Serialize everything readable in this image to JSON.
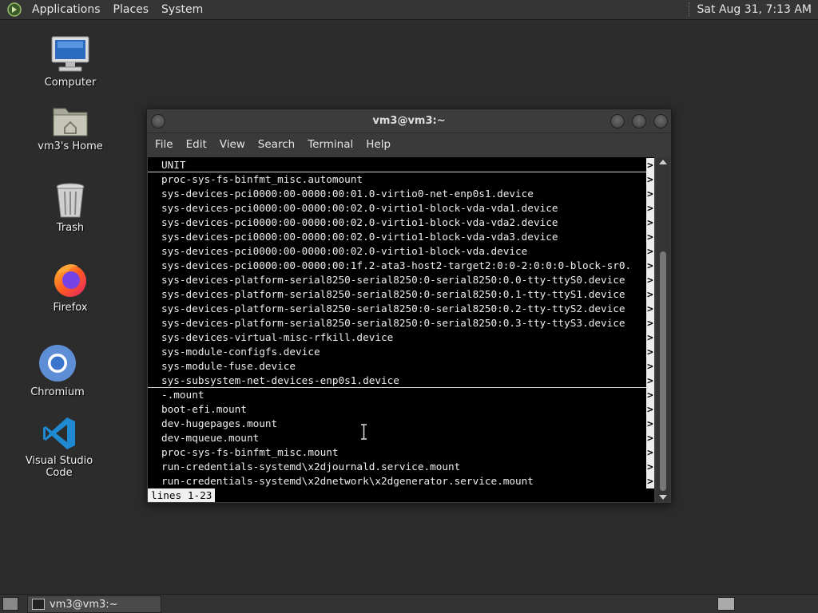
{
  "top_panel": {
    "menus": [
      "Applications",
      "Places",
      "System"
    ],
    "clock": "Sat Aug 31,  7:13 AM"
  },
  "desktop_icons": [
    {
      "label": "Computer",
      "icon": "computer-icon"
    },
    {
      "label": "vm3's Home",
      "icon": "home-folder-icon"
    },
    {
      "label": "Trash",
      "icon": "trash-icon"
    },
    {
      "label": "Firefox",
      "icon": "firefox-icon"
    },
    {
      "label": "Chromium",
      "icon": "chromium-icon"
    },
    {
      "label": "Visual Studio Code",
      "icon": "vscode-icon"
    }
  ],
  "terminal": {
    "title": "vm3@vm3:~",
    "menu": [
      "File",
      "Edit",
      "View",
      "Search",
      "Terminal",
      "Help"
    ],
    "lines": [
      "UNIT",
      "proc-sys-fs-binfmt_misc.automount",
      "sys-devices-pci0000:00-0000:00:01.0-virtio0-net-enp0s1.device",
      "sys-devices-pci0000:00-0000:00:02.0-virtio1-block-vda-vda1.device",
      "sys-devices-pci0000:00-0000:00:02.0-virtio1-block-vda-vda2.device",
      "sys-devices-pci0000:00-0000:00:02.0-virtio1-block-vda-vda3.device",
      "sys-devices-pci0000:00-0000:00:02.0-virtio1-block-vda.device",
      "sys-devices-pci0000:00-0000:00:1f.2-ata3-host2-target2:0:0-2:0:0:0-block-sr0.",
      "sys-devices-platform-serial8250-serial8250:0-serial8250:0.0-tty-ttyS0.device",
      "sys-devices-platform-serial8250-serial8250:0-serial8250:0.1-tty-ttyS1.device",
      "sys-devices-platform-serial8250-serial8250:0-serial8250:0.2-tty-ttyS2.device",
      "sys-devices-platform-serial8250-serial8250:0-serial8250:0.3-tty-ttyS3.device",
      "sys-devices-virtual-misc-rfkill.device",
      "sys-module-configfs.device",
      "sys-module-fuse.device",
      "sys-subsystem-net-devices-enp0s1.device",
      "-.mount",
      "boot-efi.mount",
      "dev-hugepages.mount",
      "dev-mqueue.mount",
      "proc-sys-fs-binfmt_misc.mount",
      "run-credentials-systemd\\x2djournald.service.mount",
      "run-credentials-systemd\\x2dnetwork\\x2dgenerator.service.mount"
    ],
    "overflow_marker": ">",
    "status": "lines 1-23"
  },
  "taskbar": {
    "window_button": "vm3@vm3:~"
  }
}
